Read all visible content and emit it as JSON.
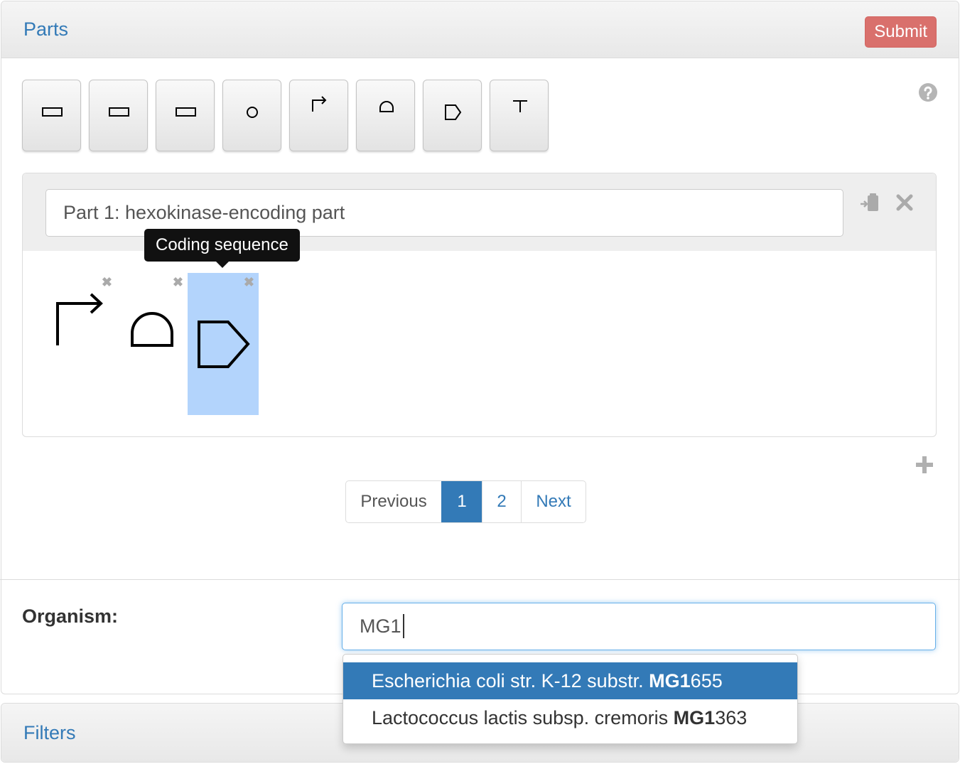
{
  "header": {
    "title": "Parts",
    "submit_label": "Submit"
  },
  "toolbar": {
    "glyphs": [
      "rectangle-icon",
      "rectangle-icon",
      "rectangle-icon",
      "circle-icon",
      "promoter-icon",
      "rbs-icon",
      "cds-icon",
      "terminator-icon"
    ]
  },
  "part": {
    "name": "Part 1: hexokinase-encoding part",
    "tooltip": "Coding sequence",
    "glyphs": [
      {
        "type": "promoter",
        "remove_label": "✖"
      },
      {
        "type": "rbs",
        "remove_label": "✖"
      },
      {
        "type": "cds",
        "remove_label": "✖",
        "selected": true
      }
    ]
  },
  "pagination": {
    "previous": "Previous",
    "pages": [
      "1",
      "2"
    ],
    "next": "Next",
    "active_page": "1"
  },
  "organism": {
    "label": "Organism:",
    "value": "MG1",
    "suggestions": [
      {
        "prefix": "Escherichia coli str. K-12 substr. ",
        "match": "MG1",
        "suffix": "655",
        "active": true
      },
      {
        "prefix": "Lactococcus lactis subsp. cremoris ",
        "match": "MG1",
        "suffix": "363",
        "active": false
      }
    ]
  },
  "filters": {
    "title": "Filters"
  },
  "colors": {
    "accent": "#337ab7",
    "submit": "#d9706c",
    "selection": "#b3d4fc"
  }
}
